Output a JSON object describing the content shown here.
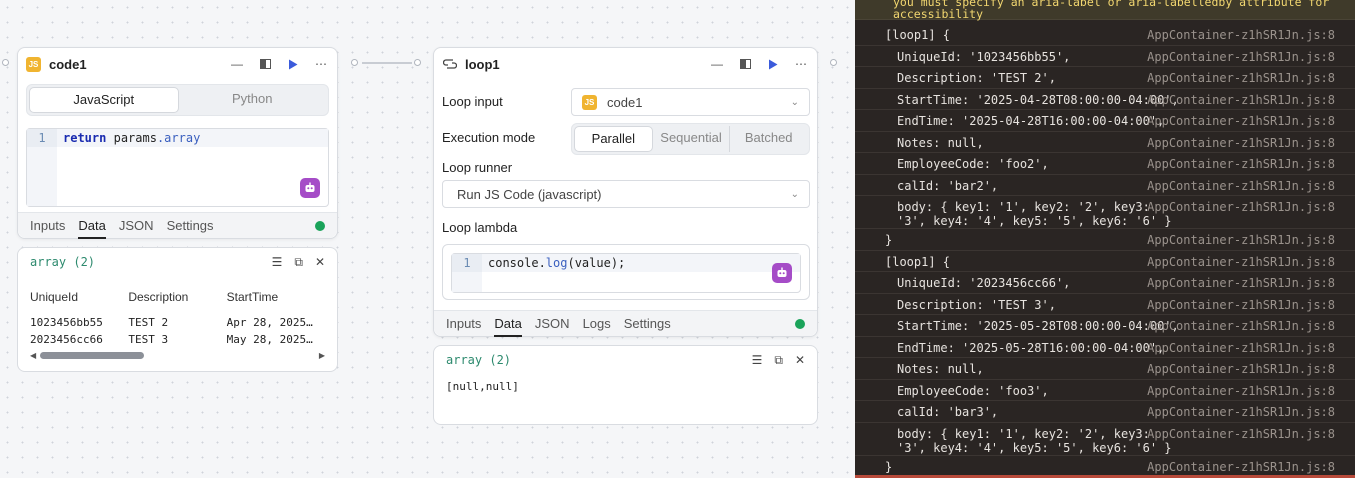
{
  "code1": {
    "title": "code1",
    "badge": "JS",
    "lang_tabs": [
      "JavaScript",
      "Python"
    ],
    "line_no": "1",
    "code_kw": "return",
    "code_obj": "params",
    "code_prop": ".array",
    "tabs": [
      "Inputs",
      "Data",
      "JSON",
      "Settings"
    ]
  },
  "code1_output": {
    "type_label": "array (2)",
    "columns": [
      "UniqueId",
      "Description",
      "StartTime"
    ],
    "rows": [
      [
        "1023456bb55",
        "TEST 2",
        "Apr 28, 2025…"
      ],
      [
        "2023456cc66",
        "TEST 3",
        "May 28, 2025…"
      ]
    ]
  },
  "loop1": {
    "title": "loop1",
    "loop_input_label": "Loop input",
    "loop_input_badge": "JS",
    "loop_input_value": "code1",
    "exec_label": "Execution mode",
    "exec_modes": [
      "Parallel",
      "Sequential",
      "Batched"
    ],
    "runner_label": "Loop runner",
    "runner_value": "Run JS Code (javascript)",
    "lambda_label": "Loop lambda",
    "line_no": "1",
    "code_obj": "console.",
    "code_fn": "log",
    "code_rest": "(value);",
    "tabs": [
      "Inputs",
      "Data",
      "JSON",
      "Logs",
      "Settings"
    ]
  },
  "loop1_output": {
    "type_label": "array (2)",
    "value": "[null,null]"
  },
  "console": {
    "warning_1": "you must specify an aria-label or aria-labelledby attribute for",
    "warning_2": "accessibility",
    "source": "AppContainer-z1hSR1Jn.js:8",
    "lines": [
      {
        "text": "[loop1] {",
        "indent": false
      },
      {
        "text": "UniqueId: '1023456bb55',",
        "indent": true
      },
      {
        "text": "Description: 'TEST 2',",
        "indent": true
      },
      {
        "text": "StartTime: '2025-04-28T08:00:00-04:00',",
        "indent": true
      },
      {
        "text": "EndTime: '2025-04-28T16:00:00-04:00',",
        "indent": true
      },
      {
        "text": "Notes: null,",
        "indent": true
      },
      {
        "text": "EmployeeCode: 'foo2',",
        "indent": true
      },
      {
        "text": "calId: 'bar2',",
        "indent": true
      },
      {
        "text": "body: { key1: '1', key2: '2', key3:\n'3', key4: '4', key5: '5', key6: '6' }",
        "indent": true
      },
      {
        "text": "}",
        "indent": false
      },
      {
        "text": "[loop1] {",
        "indent": false
      },
      {
        "text": "UniqueId: '2023456cc66',",
        "indent": true
      },
      {
        "text": "Description: 'TEST 3',",
        "indent": true
      },
      {
        "text": "StartTime: '2025-05-28T08:00:00-04:00',",
        "indent": true
      },
      {
        "text": "EndTime: '2025-05-28T16:00:00-04:00',",
        "indent": true
      },
      {
        "text": "Notes: null,",
        "indent": true
      },
      {
        "text": "EmployeeCode: 'foo3',",
        "indent": true
      },
      {
        "text": "calId: 'bar3',",
        "indent": true
      },
      {
        "text": "body: { key1: '1', key2: '2', key3:\n'3', key4: '4', key5: '5', key6: '6' }",
        "indent": true
      },
      {
        "text": "}",
        "indent": false
      }
    ]
  },
  "colors": {
    "accent": "#3b5bdb",
    "success": "#1aa35a",
    "ai": "#a54cc7",
    "js_badge": "#f0b430"
  }
}
